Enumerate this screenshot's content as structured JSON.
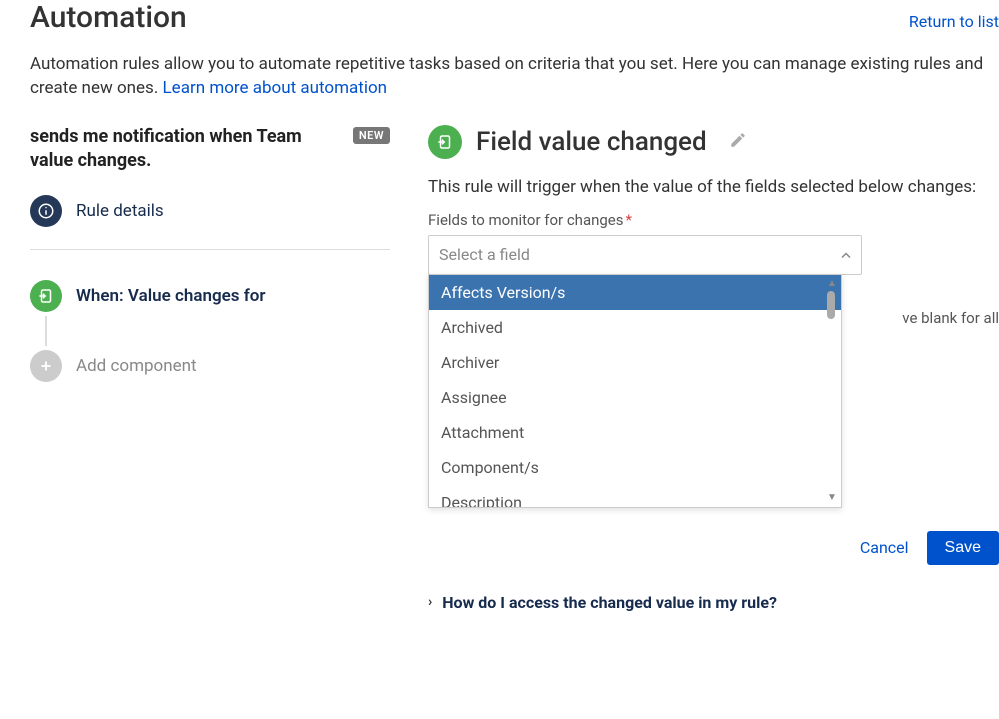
{
  "header": {
    "title": "Automation",
    "return_link": "Return to list"
  },
  "description": {
    "text": "Automation rules allow you to automate repetitive tasks based on criteria that you set. Here you can manage existing rules and create new ones. ",
    "learn_more": "Learn more about automation"
  },
  "left": {
    "rule_name": "sends me notification when Team value changes.",
    "new_badge": "NEW",
    "rule_details_label": "Rule details",
    "trigger_step_label": "When: Value changes for",
    "add_component_label": "Add component"
  },
  "right": {
    "trigger_title": "Field value changed",
    "trigger_description": "This rule will trigger when the value of the fields selected below changes:",
    "fields_label": "Fields to monitor for changes",
    "select_placeholder": "Select a field",
    "blank_hint_fragment": "ve blank for all",
    "options": [
      "Affects Version/s",
      "Archived",
      "Archiver",
      "Assignee",
      "Attachment",
      "Component/s",
      "Description"
    ],
    "cancel_label": "Cancel",
    "save_label": "Save",
    "accordion_label": "How do I access the changed value in my rule?"
  }
}
